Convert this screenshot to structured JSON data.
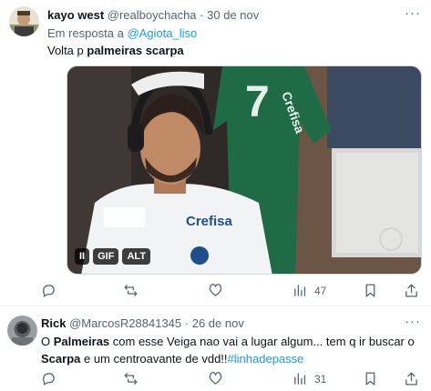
{
  "tweet1": {
    "display_name": "kayo west",
    "handle": "@realboychacha",
    "separator": "·",
    "date": "30 de nov",
    "reply_prefix": "Em resposta a",
    "reply_to": "@Agiota_liso",
    "text_before": "Volta p ",
    "text_bold": "palmeiras scarpa",
    "media": {
      "play_label": "II",
      "gif_label": "GIF",
      "alt_label": "ALT",
      "jersey_brand": "Crefisa",
      "jersey_number": "7",
      "shirt_brand": "Crefisa"
    },
    "actions": {
      "reply_count": "",
      "retweet_count": "",
      "like_count": "",
      "views_count": "47"
    }
  },
  "tweet2": {
    "display_name": "Rick",
    "handle": "@MarcosR28841345",
    "separator": "·",
    "date": "26 de nov",
    "text_p1": "O ",
    "text_bold1": "Palmeiras",
    "text_p2": " com esse Veiga nao vai a lugar algum... tem q ir buscar o",
    "text_bold2": "Scarpa",
    "text_p3": " e um centroavante de vdd!!",
    "hashtag": "#linhadepasse",
    "actions": {
      "reply_count": "",
      "retweet_count": "",
      "like_count": "",
      "views_count": "31"
    }
  },
  "colors": {
    "link": "#1d9bf0",
    "muted": "#536471",
    "text": "#0f1419",
    "border": "#eff3f4"
  },
  "icons": [
    "more-icon",
    "reply-icon",
    "retweet-icon",
    "like-icon",
    "views-icon",
    "bookmark-icon",
    "share-icon"
  ]
}
